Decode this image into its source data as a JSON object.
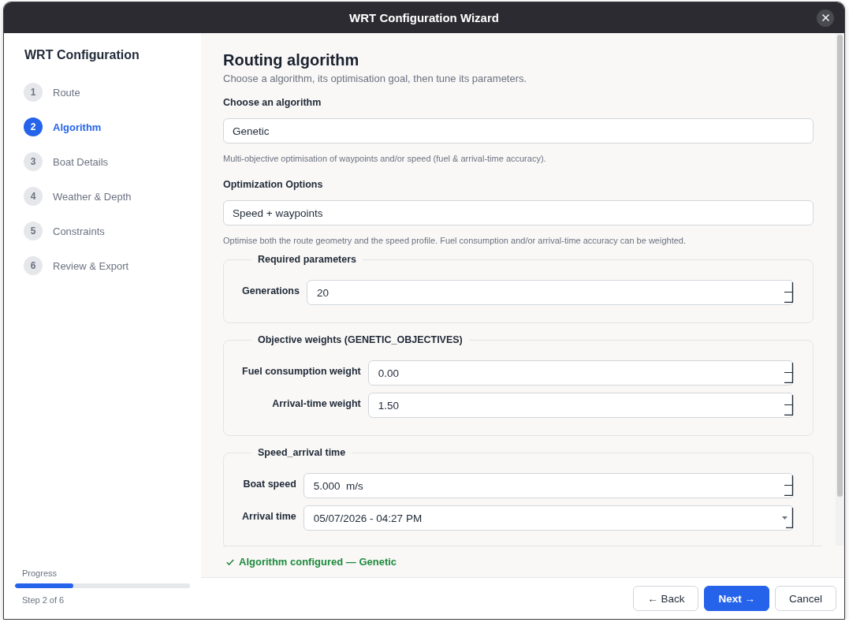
{
  "window": {
    "title": "WRT Configuration Wizard"
  },
  "sidebar": {
    "title": "WRT Configuration",
    "steps": [
      {
        "number": "1",
        "label": "Route",
        "selected": false
      },
      {
        "number": "2",
        "label": "Algorithm",
        "selected": true
      },
      {
        "number": "3",
        "label": "Boat Details",
        "selected": false
      },
      {
        "number": "4",
        "label": "Weather & Depth",
        "selected": false
      },
      {
        "number": "5",
        "label": "Constraints",
        "selected": false
      },
      {
        "number": "6",
        "label": "Review & Export",
        "selected": false
      }
    ],
    "progress": {
      "label": "Progress",
      "level": 0.333,
      "caption": "Step 2 of 6"
    }
  },
  "page": {
    "title": "Routing algorithm",
    "subtitle": "Choose a algorithm, its optimisation goal, then tune its parameters."
  },
  "fields": [
    {
      "label": "Choose an algorithm",
      "value": "Genetic",
      "help": "Multi-objective optimisation of waypoints and/or speed (fuel & arrival-time accuracy)."
    },
    {
      "label": "Optimization Options",
      "value": "Speed + waypoints",
      "help": "Optimise both the route geometry and the speed profile. Fuel consumption and/or arrival-time accuracy can be weighted."
    }
  ],
  "groups": [
    {
      "legend": "Required parameters",
      "rows": [
        {
          "label": "Generations",
          "value": "20",
          "kind": "number"
        }
      ]
    },
    {
      "legend": "Objective weights (GENETIC_OBJECTIVES)",
      "rows": [
        {
          "label": "Fuel consumption weight",
          "value": "0.00",
          "kind": "number"
        },
        {
          "label": "Arrival-time weight",
          "value": "1.50",
          "kind": "number"
        }
      ]
    },
    {
      "legend": "Speed_arrival time",
      "rows": [
        {
          "label": "Boat speed",
          "value": "5.000  m/s",
          "kind": "number"
        },
        {
          "label": "Arrival time",
          "value": "05/07/2026 - 04:27 PM",
          "kind": "datetime"
        }
      ]
    }
  ],
  "status": {
    "kind": "success",
    "text": "Algorithm configured — Genetic"
  },
  "buttons": [
    {
      "label": "← Back",
      "kind": "secondary"
    },
    {
      "label": "Next →",
      "kind": "primary"
    },
    {
      "label": "Cancel",
      "kind": "secondary"
    }
  ]
}
